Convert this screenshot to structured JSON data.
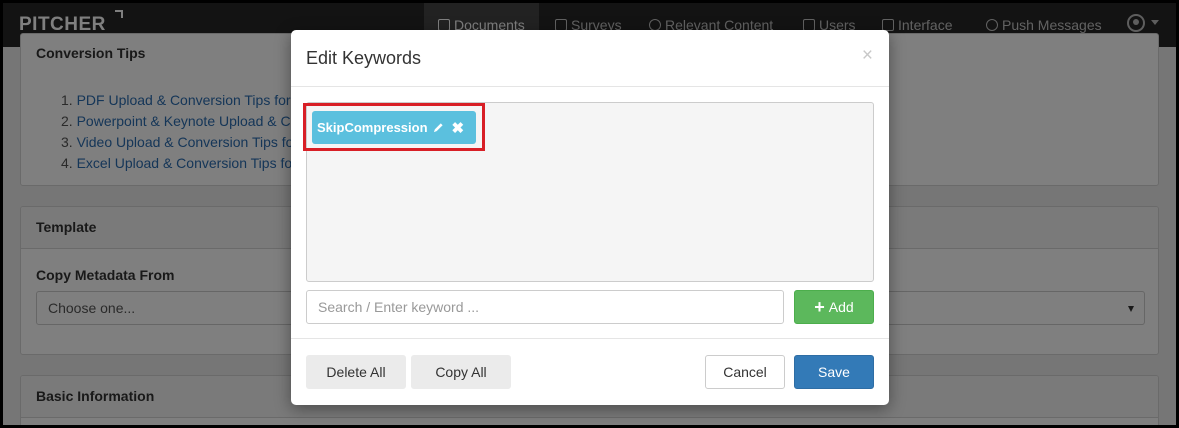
{
  "app": {
    "logo": "PITCHER"
  },
  "nav": {
    "items": [
      {
        "label": "Documents"
      },
      {
        "label": "Surveys"
      },
      {
        "label": "Relevant Content"
      },
      {
        "label": "Users"
      },
      {
        "label": "Interface"
      },
      {
        "label": "Push Messages"
      }
    ]
  },
  "background": {
    "conversion_tips": {
      "heading": "Conversion Tips",
      "items": [
        "PDF Upload & Conversion Tips for",
        "Powerpoint & Keynote Upload & C",
        "Video Upload & Conversion Tips fo",
        "Excel Upload & Conversion Tips for"
      ]
    },
    "template": {
      "heading": "Template",
      "copy_label": "Copy Metadata From",
      "select_value": "Choose one..."
    },
    "basic_info": {
      "heading": "Basic Information"
    }
  },
  "modal": {
    "title": "Edit Keywords",
    "close": "×",
    "keywords": [
      {
        "label": "SkipCompression"
      }
    ],
    "search_placeholder": "Search / Enter keyword ...",
    "add_label": "Add",
    "delete_all_label": "Delete All",
    "copy_all_label": "Copy All",
    "cancel_label": "Cancel",
    "save_label": "Save"
  },
  "colors": {
    "tag": "#5bc0de",
    "highlight": "#d81f26",
    "add_button": "#5cb85c",
    "save_button": "#337ab7",
    "nav_bg": "#262626"
  }
}
